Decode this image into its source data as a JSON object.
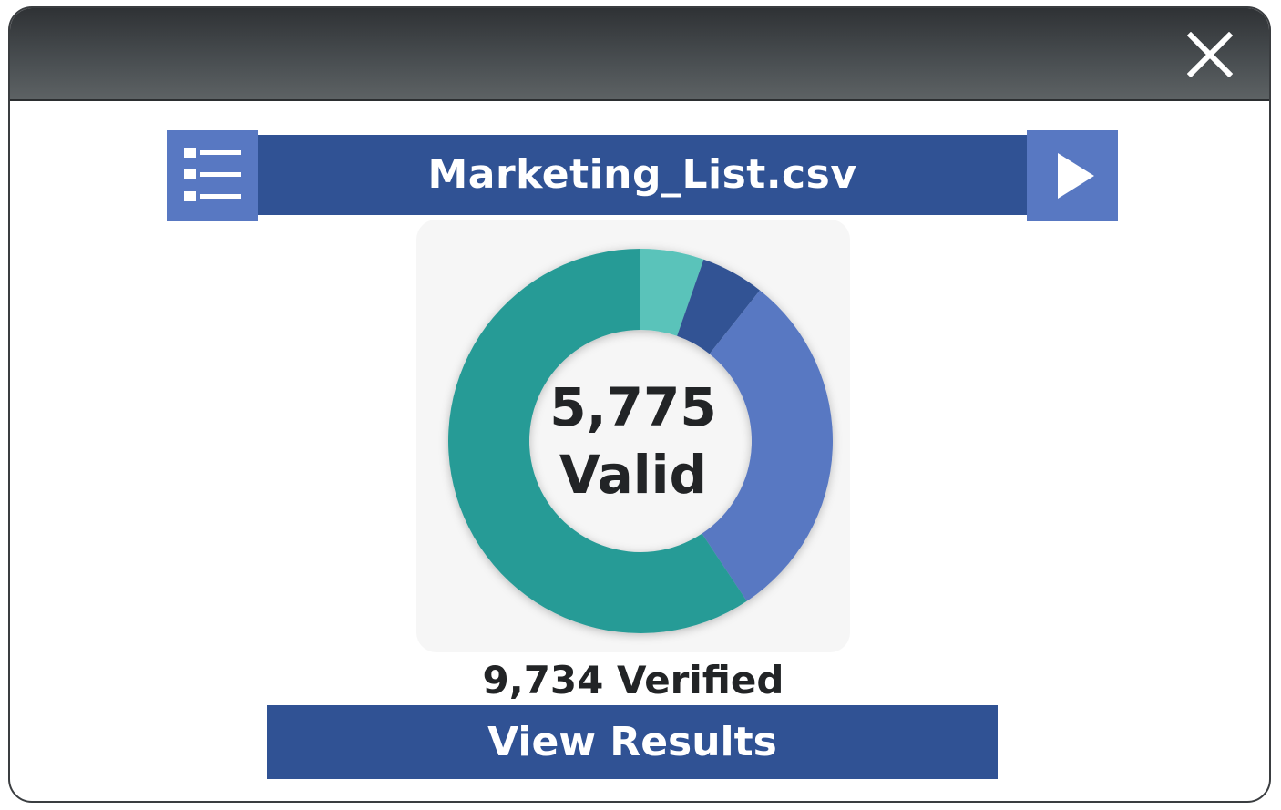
{
  "window": {
    "close_icon": "close-icon"
  },
  "file": {
    "name": "Marketing_List.csv",
    "list_icon": "list-icon",
    "play_icon": "play-icon"
  },
  "summary": {
    "valid_count": "5,775",
    "valid_label": "Valid",
    "verified_text": "9,734 Verified",
    "view_results_label": "View Results"
  },
  "colors": {
    "titlebar": "#3d4144",
    "primary_blue": "#305294",
    "light_blue": "#5878c2",
    "teal": "#289b96",
    "light_teal": "#5ac3ba",
    "text_dark": "#222426"
  },
  "chart_data": {
    "type": "pie",
    "donut": true,
    "total": 9734,
    "slices": [
      {
        "value": 519,
        "color": "#5ac3ba"
      },
      {
        "value": 519,
        "color": "#305294"
      },
      {
        "value": 2921,
        "color": "#5878c2"
      },
      {
        "value": 5775,
        "color": "#289b96"
      }
    ]
  }
}
